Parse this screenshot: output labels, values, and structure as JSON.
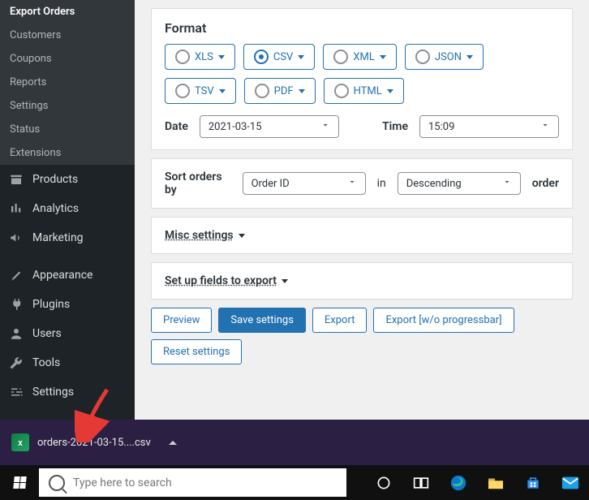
{
  "sidebar": {
    "sub_items": [
      {
        "label": "Export Orders",
        "active": true
      },
      {
        "label": "Customers",
        "active": false
      },
      {
        "label": "Coupons",
        "active": false
      },
      {
        "label": "Reports",
        "active": false
      },
      {
        "label": "Settings",
        "active": false
      },
      {
        "label": "Status",
        "active": false
      },
      {
        "label": "Extensions",
        "active": false
      }
    ],
    "menu": [
      {
        "label": "Products",
        "icon": "archive-icon"
      },
      {
        "label": "Analytics",
        "icon": "bar-chart-icon"
      },
      {
        "label": "Marketing",
        "icon": "megaphone-icon"
      },
      {
        "label": "__sep__"
      },
      {
        "label": "Appearance",
        "icon": "brush-icon"
      },
      {
        "label": "Plugins",
        "icon": "plug-icon"
      },
      {
        "label": "Users",
        "icon": "user-icon"
      },
      {
        "label": "Tools",
        "icon": "wrench-icon"
      },
      {
        "label": "Settings",
        "icon": "sliders-icon"
      }
    ]
  },
  "main": {
    "format": {
      "title": "Format",
      "options": [
        "XLS",
        "CSV",
        "XML",
        "JSON",
        "TSV",
        "PDF",
        "HTML"
      ],
      "selected": "CSV"
    },
    "date": {
      "label": "Date",
      "value": "2021-03-15"
    },
    "time": {
      "label": "Time",
      "value": "15:09"
    },
    "sort": {
      "label_prefix": "Sort orders by",
      "field": "Order ID",
      "middle": "in",
      "direction": "Descending",
      "suffix": "order"
    },
    "misc_label": "Misc settings",
    "fields_label": "Set up fields to export",
    "buttons": {
      "preview": "Preview",
      "save": "Save settings",
      "export": "Export",
      "export_wo": "Export [w/o progressbar]",
      "reset": "Reset settings"
    }
  },
  "download": {
    "filename": "orders-2021-03-15....csv"
  },
  "taskbar": {
    "search_placeholder": "Type here to search"
  }
}
